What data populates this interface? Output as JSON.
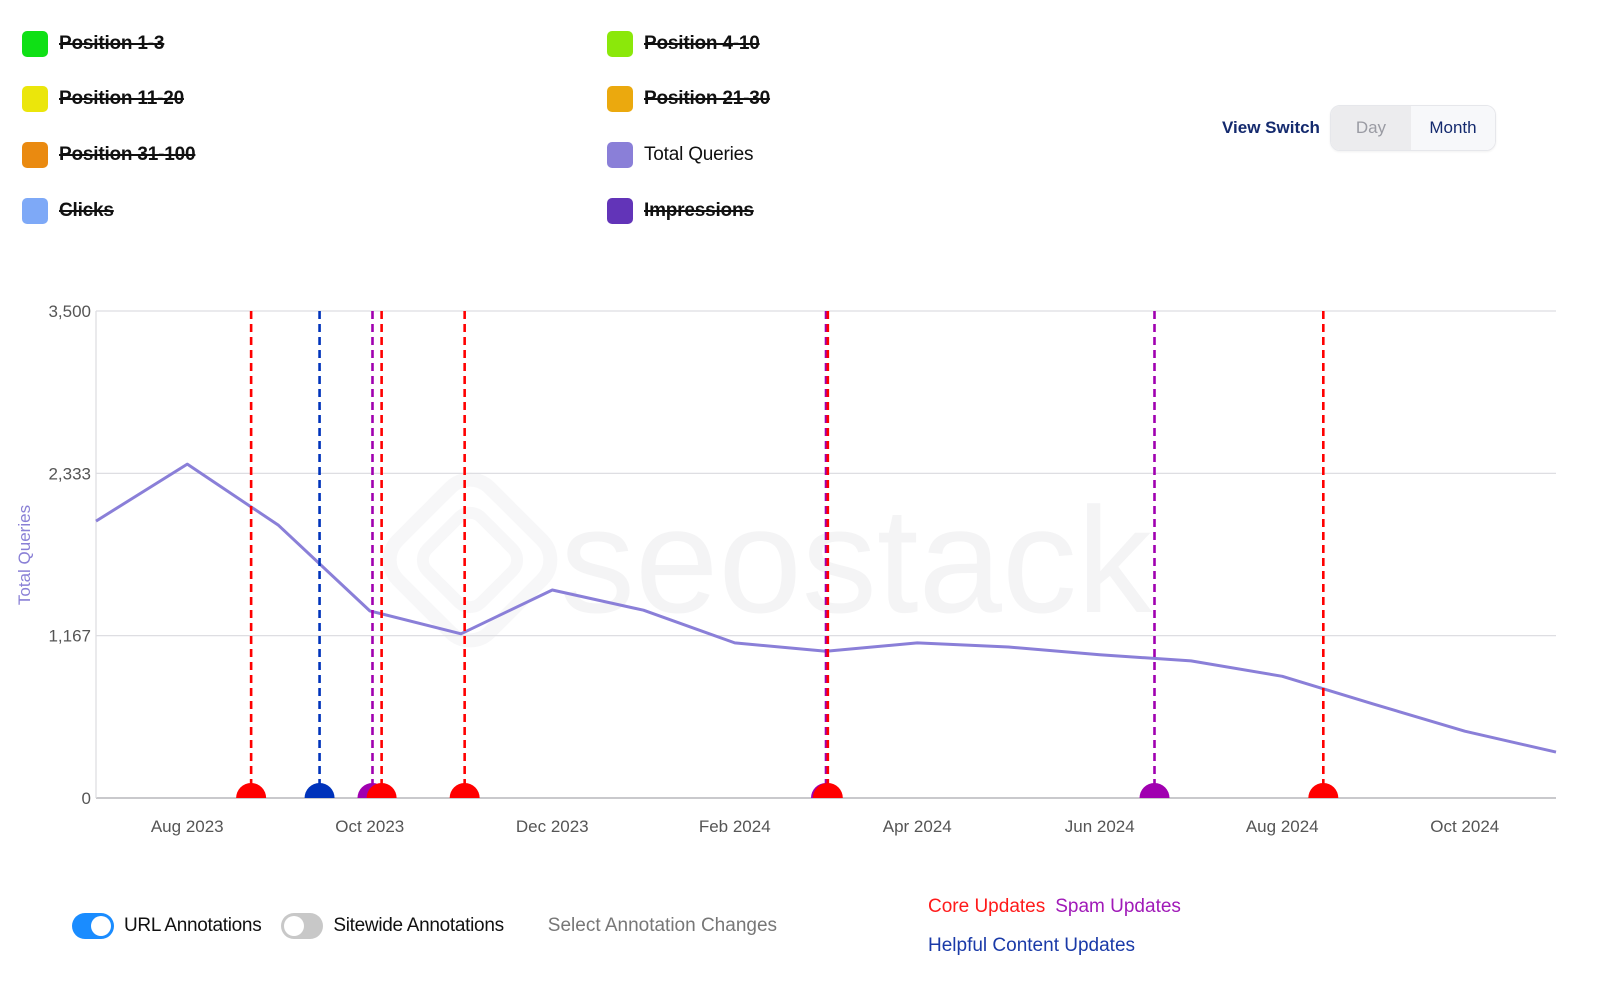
{
  "legend": {
    "items": [
      {
        "label": "Position 1-3",
        "color": "#0fe015",
        "active": false
      },
      {
        "label": "Position 4-10",
        "color": "#8be80a",
        "active": false
      },
      {
        "label": "Position 11-20",
        "color": "#ebe60b",
        "active": false
      },
      {
        "label": "Position 21-30",
        "color": "#eba90e",
        "active": false
      },
      {
        "label": "Position 31-100",
        "color": "#ea8a10",
        "active": false
      },
      {
        "label": "Total Queries",
        "color": "#8a7fd8",
        "active": true
      },
      {
        "label": "Clicks",
        "color": "#7ea9f7",
        "active": false
      },
      {
        "label": "Impressions",
        "color": "#6234b8",
        "active": false
      }
    ]
  },
  "view_switch": {
    "label": "View Switch",
    "options": [
      "Day",
      "Month"
    ],
    "selected": "Month"
  },
  "watermark": "seostack",
  "chart_data": {
    "type": "line",
    "title": "",
    "xlabel": "",
    "ylabel": "Total Queries",
    "ylim": [
      0,
      3500
    ],
    "yticks": [
      0,
      1167,
      2333,
      3500
    ],
    "ytick_labels": [
      "0",
      "1,167",
      "2,333",
      "3,500"
    ],
    "xtick_labels": [
      "Aug 2023",
      "Oct 2023",
      "Dec 2023",
      "Feb 2024",
      "Apr 2024",
      "Jun 2024",
      "Aug 2024",
      "Oct 2024"
    ],
    "xtick_months": [
      1,
      3,
      5,
      7,
      9,
      11,
      13,
      15
    ],
    "grid": true,
    "series": [
      {
        "name": "Total Queries",
        "color": "#8a7fd8",
        "x": [
          "Jul 2023",
          "Aug 2023",
          "Sep 2023",
          "Oct 2023",
          "Nov 2023",
          "Dec 2023",
          "Jan 2024",
          "Feb 2024",
          "Mar 2024",
          "Apr 2024",
          "May 2024",
          "Jun 2024",
          "Jul 2024",
          "Aug 2024",
          "Sep 2024",
          "Oct 2024",
          "Nov 2024"
        ],
        "values": [
          1990,
          2400,
          1960,
          1345,
          1180,
          1495,
          1350,
          1115,
          1055,
          1115,
          1085,
          1030,
          985,
          875,
          675,
          480,
          330
        ]
      }
    ],
    "annotations": [
      {
        "type": "core",
        "month": 1.7
      },
      {
        "type": "helpful",
        "month": 2.45
      },
      {
        "type": "spam",
        "month": 3.03
      },
      {
        "type": "core",
        "month": 3.13
      },
      {
        "type": "core",
        "month": 4.04
      },
      {
        "type": "spam",
        "month": 8.0
      },
      {
        "type": "core",
        "month": 8.02
      },
      {
        "type": "spam",
        "month": 11.6
      },
      {
        "type": "core",
        "month": 13.45
      }
    ],
    "annotation_colors": {
      "core": "#ff0000",
      "spam": "#a000b0",
      "helpful": "#0033bb"
    }
  },
  "bottom": {
    "url_annotations": {
      "label": "URL Annotations",
      "on": true
    },
    "sitewide_annotations": {
      "label": "Sitewide Annotations",
      "on": false
    },
    "select_changes": "Select Annotation Changes"
  },
  "update_legend": {
    "core": {
      "label": "Core Updates",
      "color": "#ff1a1a"
    },
    "spam": {
      "label": "Spam Updates",
      "color": "#a01ab8"
    },
    "helpful": {
      "label": "Helpful Content Updates",
      "color": "#1a3aa8"
    }
  }
}
